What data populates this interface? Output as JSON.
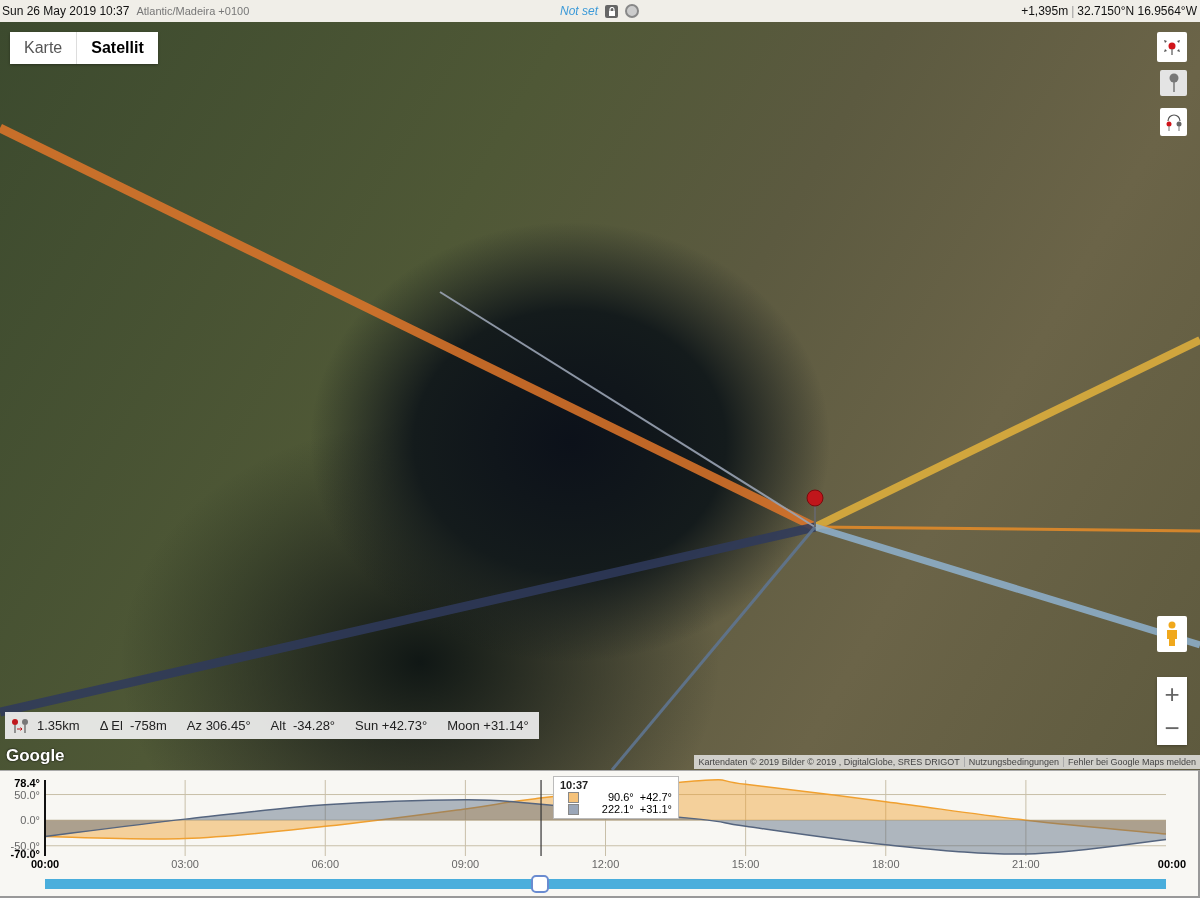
{
  "top_bar": {
    "datetime": "Sun 26 May 2019 10:37",
    "timezone": "Atlantic/Madeira +0100",
    "location_name": "Not set",
    "elevation": "+1,395m",
    "separator": "|",
    "coordinates": "32.7150°N 16.9564°W"
  },
  "map": {
    "tabs": [
      {
        "label": "Karte",
        "selected": false
      },
      {
        "label": "Satellit",
        "selected": true
      }
    ],
    "info_bar": [
      "1.35km",
      "Δ El  -758m",
      "Az 306.45°",
      "Alt  -34.28°",
      "Sun +42.73°",
      "Moon +31.14°"
    ],
    "zoom_buttons": [
      "+",
      "−"
    ],
    "logo": "Google",
    "attribution": [
      "Kartendaten © 2019 Bilder © 2019 , DigitalGlobe, SRES DRIGOT",
      "Nutzungsbedingungen",
      "Fehler bei Google Maps melden"
    ]
  },
  "bottom_panel": {
    "chart_data": {
      "type": "area",
      "x": [
        0,
        3,
        6,
        9,
        10.5,
        14,
        15,
        18,
        21,
        24
      ],
      "xticks": [
        {
          "value": 0,
          "label": "00:00"
        },
        {
          "value": 3,
          "label": "03:00"
        },
        {
          "value": 6,
          "label": "06:00"
        },
        {
          "value": 9,
          "label": "09:00"
        },
        {
          "value": 12,
          "label": "12:00"
        },
        {
          "value": 15,
          "label": "15:00"
        },
        {
          "value": 18,
          "label": "18:00"
        },
        {
          "value": 21,
          "label": "21:00"
        },
        {
          "value": 24,
          "label": "00:00"
        }
      ],
      "series": [
        {
          "color": "#f0a030",
          "values": [
            -32,
            -36,
            -12,
            22,
            42,
            77,
            70,
            36,
            0,
            -27
          ]
        },
        {
          "color": "#55657f",
          "values": [
            -32,
            2,
            30,
            40,
            32,
            2,
            -12,
            -48,
            -66,
            -38
          ]
        }
      ],
      "xlim": [
        0,
        24
      ],
      "ylim": [
        -70,
        78.4
      ],
      "grid": true,
      "ref_lines": [
        {
          "axis": "x",
          "value": 10.62
        }
      ],
      "yticks": [
        {
          "value": 78.4,
          "label": "78.4°"
        },
        {
          "value": 50,
          "label": "50.0°"
        },
        {
          "value": 0,
          "label": "0.0°"
        },
        {
          "value": -50,
          "label": "-50.0°"
        },
        {
          "value": -70,
          "label": "-70.0°"
        }
      ]
    },
    "cursor_tooltip": {
      "time": "10:37",
      "rows": [
        {
          "color": "#f5c27a",
          "azimuth": "90.6°",
          "elevation": "+42.7°"
        },
        {
          "color": "#9aa6b8",
          "azimuth": "222.1°",
          "elevation": "+31.1°"
        }
      ]
    },
    "time_slider": {
      "level": 0.442
    }
  }
}
